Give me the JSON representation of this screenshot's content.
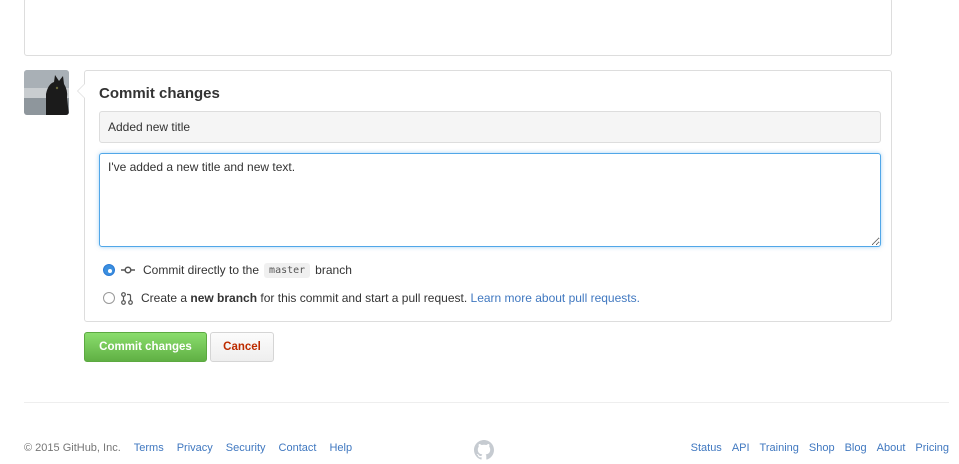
{
  "commit_form": {
    "title": "Commit changes",
    "summary_value": "Added new title",
    "description_value": "I've added a new title and new text.",
    "option_direct": {
      "prefix": "Commit directly to the",
      "branch": "master",
      "suffix": "branch",
      "checked": true
    },
    "option_new_branch": {
      "prefix": "Create a",
      "bold": "new branch",
      "suffix": "for this commit and start a pull request.",
      "link": "Learn more about pull requests.",
      "checked": false
    }
  },
  "buttons": {
    "commit_label": "Commit changes",
    "cancel_label": "Cancel"
  },
  "footer": {
    "copyright": "© 2015 GitHub, Inc.",
    "left_links": [
      "Terms",
      "Privacy",
      "Security",
      "Contact",
      "Help"
    ],
    "right_links": [
      "Status",
      "API",
      "Training",
      "Shop",
      "Blog",
      "About",
      "Pricing"
    ]
  },
  "icons": {
    "commit": "git-commit-icon",
    "pull_request": "git-pull-request-icon",
    "footer_logo": "github-mark-icon"
  },
  "colors": {
    "link": "#4078c0",
    "commit_button": "#60b044",
    "cancel_text": "#bd2c00",
    "focus_border": "#51a7e8"
  }
}
